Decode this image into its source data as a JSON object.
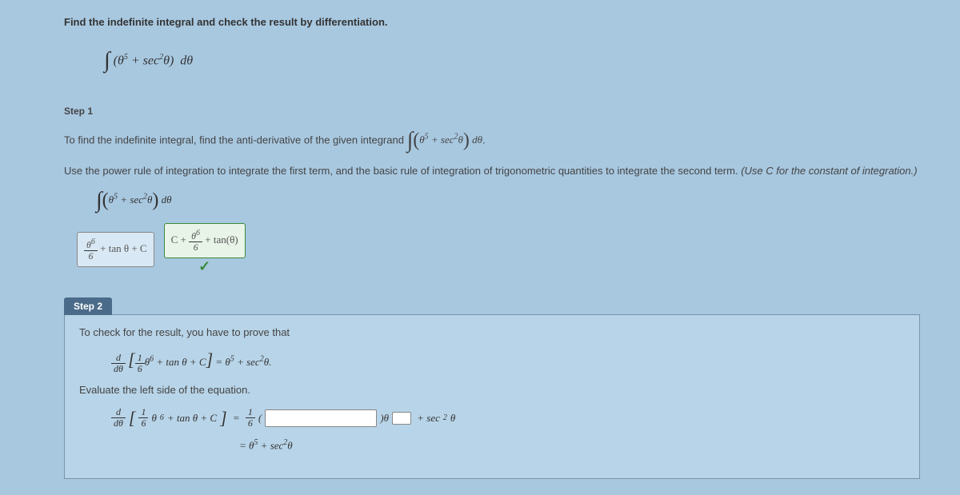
{
  "question": "Find the indefinite integral and check the result by differentiation.",
  "main_integral_html": "∫ (θ⁵ + sec²θ) dθ",
  "step1": {
    "label": "Step 1",
    "line1a": "To find the indefinite integral, find the anti-derivative of the given integrand ",
    "integrand_html": "∫ (θ⁵ + sec²θ) dθ.",
    "line2": "Use the power rule of integration to integrate the first term, and the basic rule of integration of trigonometric quantities to integrate the second term. ",
    "hint": "(Use C for the constant of integration.)",
    "integral_line": "∫ (θ⁵ + sec²θ) dθ",
    "answer_entered": "θ⁶/6 + tan θ + C",
    "answer_correct": "C + θ⁶/6 + tan(θ)"
  },
  "step2": {
    "label": "Step 2",
    "line1": "To check for the result, you have to prove that",
    "prove_eq": "d/dθ [ (1/6)θ⁶ + tan θ + C ] = θ⁵ + sec²θ.",
    "line2": "Evaluate the left side of the equation.",
    "eval_lhs": "d/dθ [ (1/6)θ⁶ + tan θ + C ] = (1/6)(",
    "eval_mid": ")θ",
    "eval_tail": " + sec²θ",
    "result_line": "= θ⁵ + sec²θ"
  }
}
